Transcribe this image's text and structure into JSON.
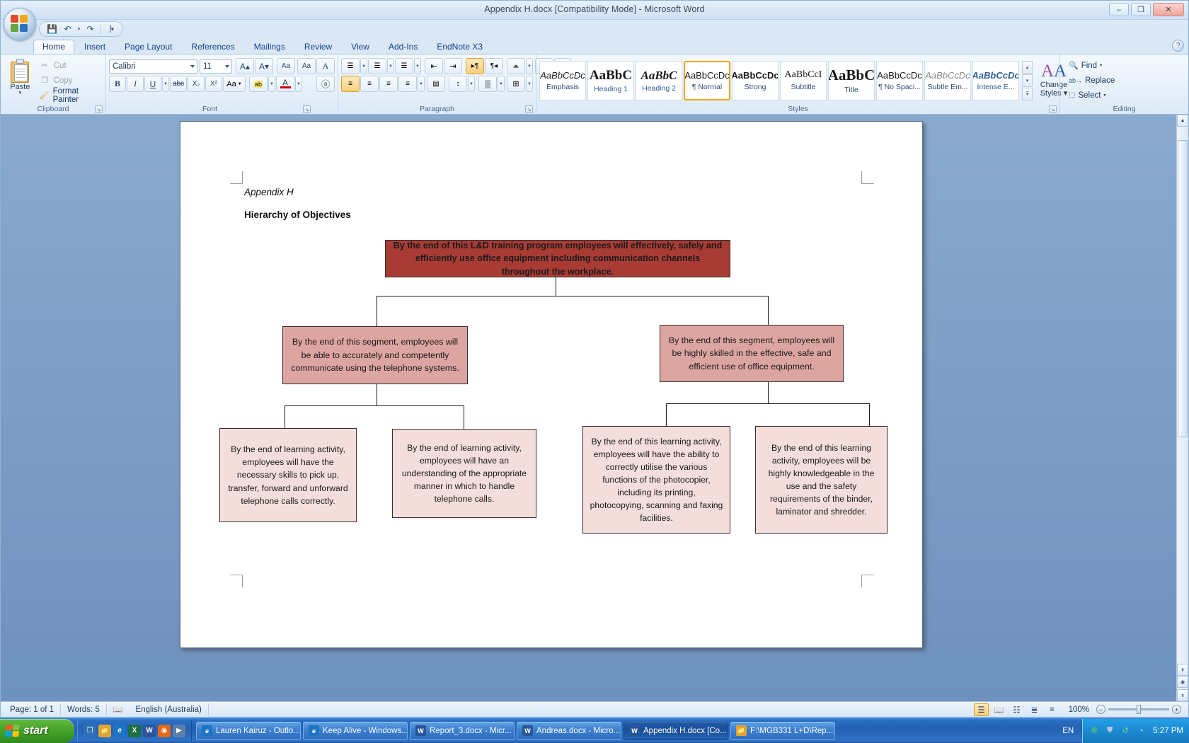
{
  "window": {
    "title": "Appendix H.docx [Compatibility Mode] - Microsoft Word",
    "minimize_label": "–",
    "maximize_label": "❐",
    "close_label": "✕",
    "help_label": "?"
  },
  "quick_access": {
    "save_label": "💾",
    "undo_label": "↶",
    "undo_dropdown_label": "▾",
    "redo_label": "↷",
    "customize_label": "▕▾"
  },
  "ribbon": {
    "tabs": [
      {
        "label": "Home",
        "active": true
      },
      {
        "label": "Insert",
        "active": false
      },
      {
        "label": "Page Layout",
        "active": false
      },
      {
        "label": "References",
        "active": false
      },
      {
        "label": "Mailings",
        "active": false
      },
      {
        "label": "Review",
        "active": false
      },
      {
        "label": "View",
        "active": false
      },
      {
        "label": "Add-Ins",
        "active": false
      },
      {
        "label": "EndNote X3",
        "active": false
      }
    ],
    "groups": {
      "clipboard": {
        "label": "Clipboard",
        "paste_label": "Paste",
        "paste_dropdown": "▾",
        "cut_label": "Cut",
        "copy_label": "Copy",
        "format_painter_label": "Format Painter",
        "cut_icon": "✂",
        "copy_icon": "❐",
        "format_painter_icon": "🖌",
        "launcher": "↘"
      },
      "font": {
        "label": "Font",
        "font_family_value": "Calibri",
        "font_size_value": "11",
        "grow_font": "A▴",
        "shrink_font": "A▾",
        "clear_formatting": "Aa",
        "change_case": "Aa",
        "bold": "B",
        "italic": "I",
        "underline": "U",
        "strikethrough": "abc",
        "subscript": "X₂",
        "superscript": "X²",
        "text_highlight": "ab",
        "font_color": "A",
        "text_effects": "A",
        "phonetic_guide": "ⓐ",
        "launcher": "↘"
      },
      "paragraph": {
        "label": "Paragraph",
        "bullets": "☰",
        "numbering": "☰",
        "multilevel": "☰",
        "decrease_indent": "⇤",
        "increase_indent": "⇥",
        "ltr": "▸¶",
        "rtl": "¶◂",
        "sort": "A↓",
        "show_marks": "¶",
        "align_left": "≡",
        "align_center": "≡",
        "align_right": "≡",
        "justify": "≡",
        "line_spacing": "↕",
        "shading": "▒",
        "borders": "⊞",
        "launcher": "↘"
      },
      "styles": {
        "label": "Styles",
        "change_styles_label": "Change\nStyles",
        "change_styles_line1": "Change",
        "change_styles_line2": "Styles ▾",
        "scroll_up": "▴",
        "scroll_down": "▾",
        "scroll_more": "▾̅",
        "launcher": "↘",
        "items": [
          {
            "preview": "AaBbCcDc",
            "name": "Emphasis",
            "selected": false,
            "style": "italic"
          },
          {
            "preview": "AaBbC",
            "name": "Heading 1",
            "selected": false,
            "style": "h1"
          },
          {
            "preview": "AaBbC",
            "name": "Heading 2",
            "selected": false,
            "style": "h2"
          },
          {
            "preview": "AaBbCcDc",
            "name": "¶ Normal",
            "selected": true,
            "style": "normal"
          },
          {
            "preview": "AaBbCcDc",
            "name": "Strong",
            "selected": false,
            "style": "strong"
          },
          {
            "preview": "AaBbCcI",
            "name": "Subtitle",
            "selected": false,
            "style": "subtitle"
          },
          {
            "preview": "AaBbC",
            "name": "Title",
            "selected": false,
            "style": "title"
          },
          {
            "preview": "AaBbCcDc",
            "name": "¶ No Spaci...",
            "selected": false,
            "style": "normal"
          },
          {
            "preview": "AaBbCcDc",
            "name": "Subtle Em...",
            "selected": false,
            "style": "subtle"
          },
          {
            "preview": "AaBbCcDc",
            "name": "Intense E...",
            "selected": false,
            "style": "intense"
          }
        ]
      },
      "editing": {
        "label": "Editing",
        "find_label": "Find",
        "find_icon": "🔍",
        "find_dropdown": "▾",
        "replace_label": "Replace",
        "replace_icon": "ab→",
        "select_label": "Select",
        "select_icon": "⬚",
        "select_dropdown": "▾"
      }
    }
  },
  "document": {
    "appendix_label": "Appendix H",
    "heading": "Hierarchy of Objectives",
    "colors": {
      "level1_fill": "#a93b35",
      "level2_fill": "#dda5a1",
      "level3_fill": "#f3dedc",
      "border": "#2f2f2f"
    },
    "nodes": {
      "goal": "By the end of this L&D training program employees will effectively, safely and efficiently use office equipment including communication channels throughout the workplace.",
      "segment_left": "By the end of this segment, employees will be able to accurately and competently communicate using the telephone systems.",
      "segment_right": "By the end of this segment, employees will be highly skilled in the effective, safe and efficient use of office equipment.",
      "activity_1": "By the end of learning activity, employees will have the necessary skills to pick up, transfer, forward and unforward telephone calls correctly.",
      "activity_2": "By the end of learning activity, employees will have an understanding of the appropriate manner in which to handle telephone calls.",
      "activity_3": "By the end of this learning activity, employees will have the ability to correctly utilise the various functions of the photocopier, including its printing, photocopying, scanning and faxing facilities.",
      "activity_4": "By the end of this learning activity, employees will be highly knowledgeable in the use and the safety requirements of the binder, laminator and shredder."
    }
  },
  "status_bar": {
    "page_label": "Page: 1 of 1",
    "words_label": "Words: 5",
    "proofing_icon": "📖",
    "language_label": "English (Australia)",
    "zoom_label": "100%",
    "zoom_out": "−",
    "zoom_in": "+",
    "views": [
      {
        "name": "print-layout",
        "glyph": "☰",
        "selected": true
      },
      {
        "name": "full-screen-reading",
        "glyph": "📖",
        "selected": false
      },
      {
        "name": "web-layout",
        "glyph": "☷",
        "selected": false
      },
      {
        "name": "outline",
        "glyph": "≣",
        "selected": false
      },
      {
        "name": "draft",
        "glyph": "≡",
        "selected": false
      }
    ]
  },
  "taskbar": {
    "start_label": "start",
    "quick_launch": [
      {
        "name": "show-desktop-icon",
        "glyph": "❐",
        "color": "#2f6fb5"
      },
      {
        "name": "folder-icon",
        "glyph": "📁",
        "color": "#e0a436"
      },
      {
        "name": "internet-explorer-icon",
        "glyph": "e",
        "color": "#1c74c4"
      },
      {
        "name": "excel-icon",
        "glyph": "X",
        "color": "#1d7044"
      },
      {
        "name": "word-icon",
        "glyph": "W",
        "color": "#2a5699"
      },
      {
        "name": "firefox-icon",
        "glyph": "◉",
        "color": "#e4671a"
      },
      {
        "name": "media-icon",
        "glyph": "▶",
        "color": "#5a7fa8"
      }
    ],
    "tasks": [
      {
        "label": "Lauren Kairuz - Outlo...",
        "icon": "e",
        "icon_color": "#1c74c4",
        "active": false
      },
      {
        "label": "Keep Alive - Windows...",
        "icon": "e",
        "icon_color": "#1c74c4",
        "active": false
      },
      {
        "label": "Report_3.docx - Micr...",
        "icon": "W",
        "icon_color": "#2a5699",
        "active": false
      },
      {
        "label": "Andreas.docx - Micro...",
        "icon": "W",
        "icon_color": "#2a5699",
        "active": false
      },
      {
        "label": "Appendix H.docx [Co...",
        "icon": "W",
        "icon_color": "#2a5699",
        "active": true
      },
      {
        "label": "F:\\MGB331 L+D\\Rep...",
        "icon": "📁",
        "icon_color": "#e0a436",
        "active": false
      }
    ],
    "language_indicator": "EN",
    "tray": [
      {
        "name": "network-icon",
        "glyph": "✇"
      },
      {
        "name": "security-shield-icon",
        "glyph": "⛊"
      },
      {
        "name": "update-icon",
        "glyph": "↺"
      },
      {
        "name": "volume-icon",
        "glyph": "◔"
      }
    ],
    "clock": "5:27 PM"
  }
}
